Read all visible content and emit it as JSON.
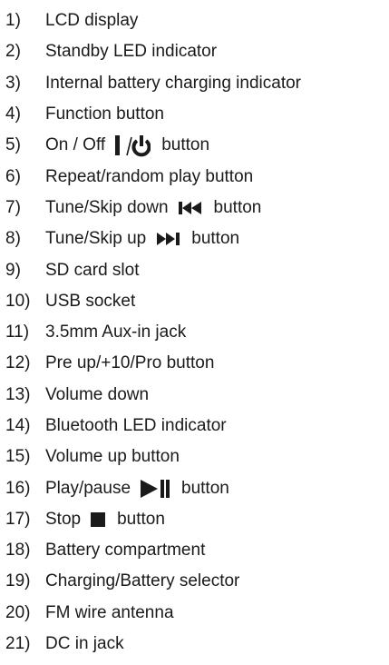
{
  "items": [
    {
      "num": "1)",
      "label": "LCD display"
    },
    {
      "num": "2)",
      "label": "Standby LED indicator"
    },
    {
      "num": "3)",
      "label": "Internal battery charging indicator"
    },
    {
      "num": "4)",
      "label": "Function button"
    },
    {
      "num": "5)",
      "label": "On / Off",
      "icon": "power-icon",
      "suffix": "button"
    },
    {
      "num": "6)",
      "label": "Repeat/random play button"
    },
    {
      "num": "7)",
      "label": "Tune/Skip down",
      "icon": "skip-back-icon",
      "suffix": "button"
    },
    {
      "num": "8)",
      "label": "Tune/Skip up",
      "icon": "skip-forward-icon",
      "suffix": "button"
    },
    {
      "num": "9)",
      "label": "SD card slot"
    },
    {
      "num": "10)",
      "label": "USB socket"
    },
    {
      "num": "11)",
      "label": "3.5mm Aux-in jack"
    },
    {
      "num": "12)",
      "label": "Pre up/+10/Pro button"
    },
    {
      "num": "13)",
      "label": "Volume down"
    },
    {
      "num": "14)",
      "label": "Bluetooth LED indicator"
    },
    {
      "num": "15)",
      "label": "Volume up button"
    },
    {
      "num": "16)",
      "label": "Play/pause",
      "icon": "play-pause-icon",
      "suffix": "button"
    },
    {
      "num": "17)",
      "label": "Stop",
      "icon": "stop-icon",
      "suffix": "button"
    },
    {
      "num": "18)",
      "label": "Battery compartment"
    },
    {
      "num": "19)",
      "label": "Charging/Battery selector"
    },
    {
      "num": "20)",
      "label": "FM wire antenna"
    },
    {
      "num": "21)",
      "label": "DC in jack"
    }
  ]
}
